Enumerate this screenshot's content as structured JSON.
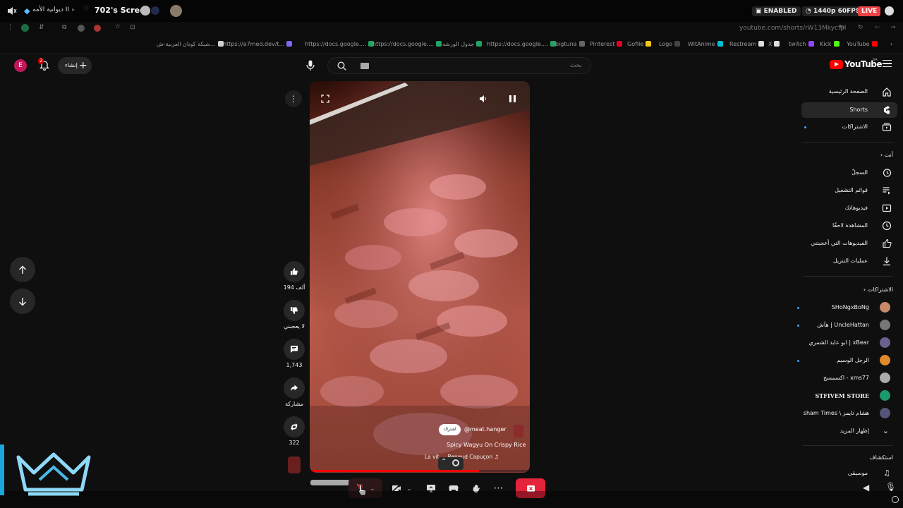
{
  "topbar": {
    "server_name": "ديوانية الأمه II",
    "screen_title": "702's Screen",
    "enabled_badge": "ENABLED",
    "quality_badge": "1440p 60FPS",
    "live_badge": "LIVE"
  },
  "browser": {
    "url": "youtube.com/shorts/rW13Mkycfpl"
  },
  "bookmarks": [
    {
      "label": "شبكة كونان العربية-ش...",
      "color": "#d0d0d0"
    },
    {
      "label": "https://a7med.dev/t...",
      "color": "#7b68ee"
    },
    {
      "label": "https://docs.google....",
      "color": "#bdbdbd"
    },
    {
      "label": "https://docs.google....",
      "color": "#21a366"
    },
    {
      "label": "جدول الورشه",
      "color": "#21a366"
    },
    {
      "label": "https://docs.google....",
      "color": "#21a366"
    },
    {
      "label": "bigtuna",
      "color": "#21a366"
    },
    {
      "label": "Pinterest",
      "color": "#666"
    },
    {
      "label": "Gofile",
      "color": "#e60023"
    },
    {
      "label": "Logo",
      "color": "#f5c518"
    },
    {
      "label": "WitAnime",
      "color": "#444"
    },
    {
      "label": "Restream",
      "color": "#00bcd4"
    },
    {
      "label": "X",
      "color": "#ddd"
    },
    {
      "label": "twitch",
      "color": "#ddd"
    },
    {
      "label": "Kick",
      "color": "#9146ff"
    },
    {
      "label": "YouTube",
      "color": "#53fc18"
    }
  ],
  "youtube": {
    "logo_text": "YouTube",
    "logo_region": "SA",
    "create_label": "إنشاء",
    "notif_count": "2",
    "account_initial": "E",
    "search_placeholder": "بحث",
    "sidebar": {
      "main": [
        {
          "label": "الصفحة الرئيسية"
        },
        {
          "label": "Shorts"
        },
        {
          "label": "الاشتراكات"
        }
      ],
      "you_heading": "أنت",
      "you_items": [
        {
          "label": "السجلّ"
        },
        {
          "label": "قوائم التشغيل"
        },
        {
          "label": "فيديوهاتك"
        },
        {
          "label": "المشاهدة لاحقًا"
        },
        {
          "label": "الفيديوهات التي أعجبتني"
        },
        {
          "label": "عمليات التنزيل"
        }
      ],
      "subs_heading": "الاشتراكات",
      "subs": [
        {
          "label": "SHoNgxBoNg",
          "avatar_color": "#c98a6a"
        },
        {
          "label": "هآش | UncleHattan",
          "avatar_color": "#777"
        },
        {
          "label": "ابو عابد الشمري | xBear",
          "avatar_color": "#6b5f8c"
        },
        {
          "label": "الرجل الوسيم",
          "avatar_color": "#e08a2c"
        },
        {
          "label": "اكسمسح - xms77",
          "avatar_color": "#aaa"
        },
        {
          "label": "STFIVEM STORE",
          "avatar_color": "#1d9a6c"
        },
        {
          "label": "هشام تايمز \\ Hisham Times",
          "avatar_color": "#557"
        }
      ],
      "show_more": "إظهار المزيد",
      "explore_heading": "استكشاف",
      "explore_items": [
        {
          "label": "موسيقى"
        }
      ]
    },
    "short": {
      "channel": "@meat.hanger",
      "subscribe_label": "اشتراك",
      "title": "Spicy Wagyu On Crispy Rice",
      "sound": "La vit ... Renaud Capuçon",
      "likes": "194 ألف",
      "dislike_label": "لا يعجبني",
      "comments": "1,743",
      "share_label": "مشاركة",
      "remix": "322"
    }
  },
  "colors": {
    "accent_red": "#ff0000",
    "share_stop_red": "#e5243b",
    "live_red": "#ed4245"
  },
  "icons": {
    "nav": [
      "arrow-up-icon",
      "arrow-down-icon"
    ],
    "toolbar": [
      "mic-muted-icon",
      "camera-off-icon",
      "screen-share-icon",
      "gamepad-icon",
      "hand-wave-icon",
      "more-icon",
      "end-share-icon"
    ]
  }
}
